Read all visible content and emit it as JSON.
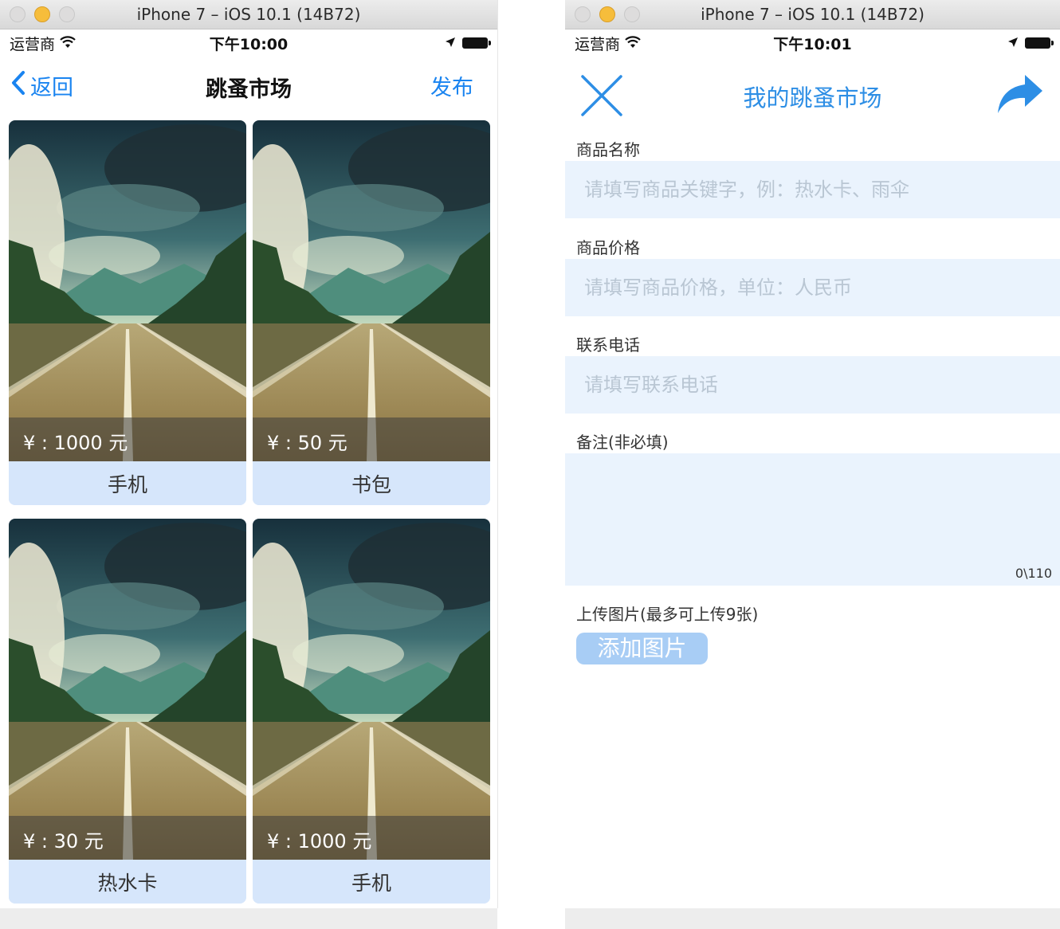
{
  "left_window": {
    "title": "iPhone 7 – iOS 10.1 (14B72)",
    "status": {
      "carrier": "运营商",
      "time": "下午10:00"
    },
    "nav": {
      "back_label": "返回",
      "title": "跳蚤市场",
      "publish_label": "发布"
    },
    "items": [
      {
        "price": "¥ : 1000 元",
        "name": "手机"
      },
      {
        "price": "¥ : 50 元",
        "name": "书包"
      },
      {
        "price": "¥ : 30 元",
        "name": "热水卡"
      },
      {
        "price": "¥ : 1000 元",
        "name": "手机"
      }
    ]
  },
  "right_window": {
    "title": "iPhone 7 – iOS 10.1 (14B72)",
    "status": {
      "carrier": "运营商",
      "time": "下午10:01"
    },
    "nav": {
      "title": "我的跳蚤市场"
    },
    "form": {
      "name_label": "商品名称",
      "name_placeholder": "请填写商品关键字，例：热水卡、雨伞",
      "price_label": "商品价格",
      "price_placeholder": "请填写商品价格，单位：人民币",
      "phone_label": "联系电话",
      "phone_placeholder": "请填写联系电话",
      "note_label": "备注(非必填)",
      "note_counter": "0\\110",
      "upload_label": "上传图片(最多可上传9张)",
      "add_image_label": "添加图片"
    }
  },
  "colors": {
    "accent_blue": "#1a84f0",
    "title_blue": "#2d8ee5",
    "field_bg": "#eaf3fd",
    "card_name_bg": "#d6e6fb",
    "button_bg": "#a8cdf5"
  }
}
